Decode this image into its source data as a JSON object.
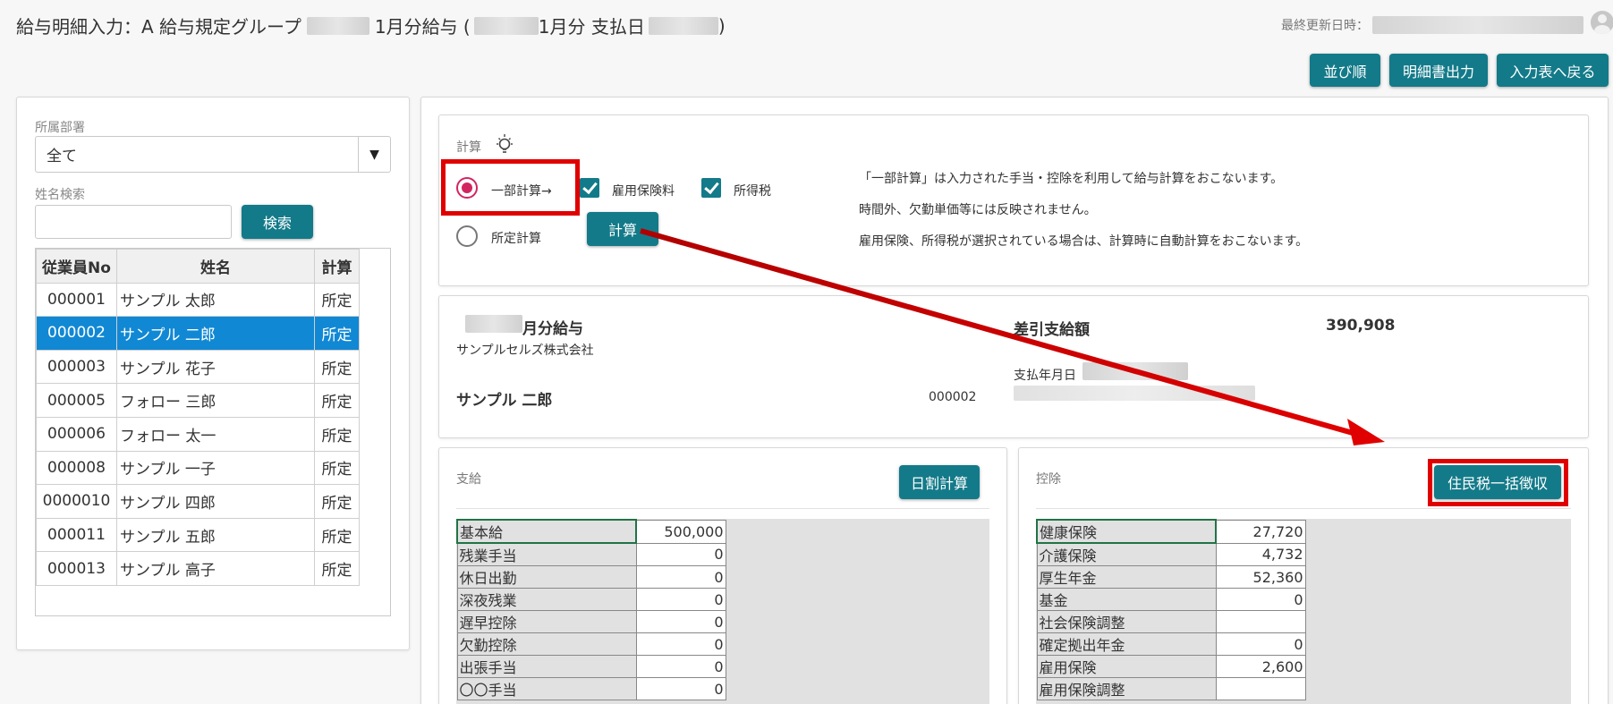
{
  "header": {
    "title_prefix": "給与明細入力：A 給与規定グループ",
    "title_mid1": "1月分給与 (",
    "title_mid2": "1月分 支払日",
    "title_suffix": ")",
    "last_updated_label": "最終更新日時："
  },
  "toolbar": {
    "sort_label": "並び順",
    "statement_label": "明細書出力",
    "back_label": "入力表へ戻る"
  },
  "sidebar": {
    "dept_label": "所属部署",
    "dept_value": "全て",
    "name_search_label": "姓名検索",
    "name_search_value": "",
    "search_button": "検索",
    "columns": [
      "従業員No",
      "姓名",
      "計算"
    ],
    "rows": [
      {
        "no": "000001",
        "name": "サンプル 太郎",
        "calc": "所定"
      },
      {
        "no": "000002",
        "name": "サンプル 二郎",
        "calc": "所定"
      },
      {
        "no": "000003",
        "name": "サンプル 花子",
        "calc": "所定"
      },
      {
        "no": "000005",
        "name": "フォロー 三郎",
        "calc": "所定"
      },
      {
        "no": "000006",
        "name": "フォロー 太一",
        "calc": "所定"
      },
      {
        "no": "000008",
        "name": "サンプル 一子",
        "calc": "所定"
      },
      {
        "no": "0000010",
        "name": "サンプル 四郎",
        "calc": "所定"
      },
      {
        "no": "000011",
        "name": "サンプル 五郎",
        "calc": "所定"
      },
      {
        "no": "000013",
        "name": "サンプル 高子",
        "calc": "所定"
      }
    ]
  },
  "calc": {
    "label": "計算",
    "partial_label": "一部計算→",
    "standard_label": "所定計算",
    "employment_ins_label": "雇用保険料",
    "income_tax_label": "所得税",
    "calc_button": "計算",
    "note1": "「一部計算」は入力された手当・控除を利用して給与計算をおこないます。",
    "note2": "時間外、欠勤単価等には反映されません。",
    "note3": "雇用保険、所得税が選択されている場合は、計算時に自動計算をおこないます。"
  },
  "summary": {
    "period_label": "月分給与",
    "company": "サンプルセルズ株式会社",
    "employee_name": "サンプル 二郎",
    "employee_no": "000002",
    "net_pay_label": "差引支給額",
    "net_pay_value": "390,908",
    "pay_date_label": "支払年月日"
  },
  "payments": {
    "title": "支給",
    "daily_calc_button": "日割計算",
    "items": [
      {
        "label": "基本給",
        "value": "500,000"
      },
      {
        "label": "残業手当",
        "value": "0"
      },
      {
        "label": "休日出勤",
        "value": "0"
      },
      {
        "label": "深夜残業",
        "value": "0"
      },
      {
        "label": "遅早控除",
        "value": "0"
      },
      {
        "label": "欠勤控除",
        "value": "0"
      },
      {
        "label": "出張手当",
        "value": "0"
      },
      {
        "label": "〇〇手当",
        "value": "0"
      }
    ]
  },
  "deductions": {
    "title": "控除",
    "resident_tax_button": "住民税一括徴収",
    "items": [
      {
        "label": "健康保険",
        "value": "27,720"
      },
      {
        "label": "介護保険",
        "value": "4,732"
      },
      {
        "label": "厚生年金",
        "value": "52,360"
      },
      {
        "label": "基金",
        "value": "0"
      },
      {
        "label": "社会保険調整",
        "value": ""
      },
      {
        "label": "確定拠出年金",
        "value": "0"
      },
      {
        "label": "雇用保険",
        "value": "2,600"
      },
      {
        "label": "雇用保険調整",
        "value": ""
      }
    ]
  },
  "colors": {
    "accent": "#137a89",
    "selected_row": "#1188d4",
    "annotation_red": "#e00000",
    "radio_active": "#d2255f"
  }
}
